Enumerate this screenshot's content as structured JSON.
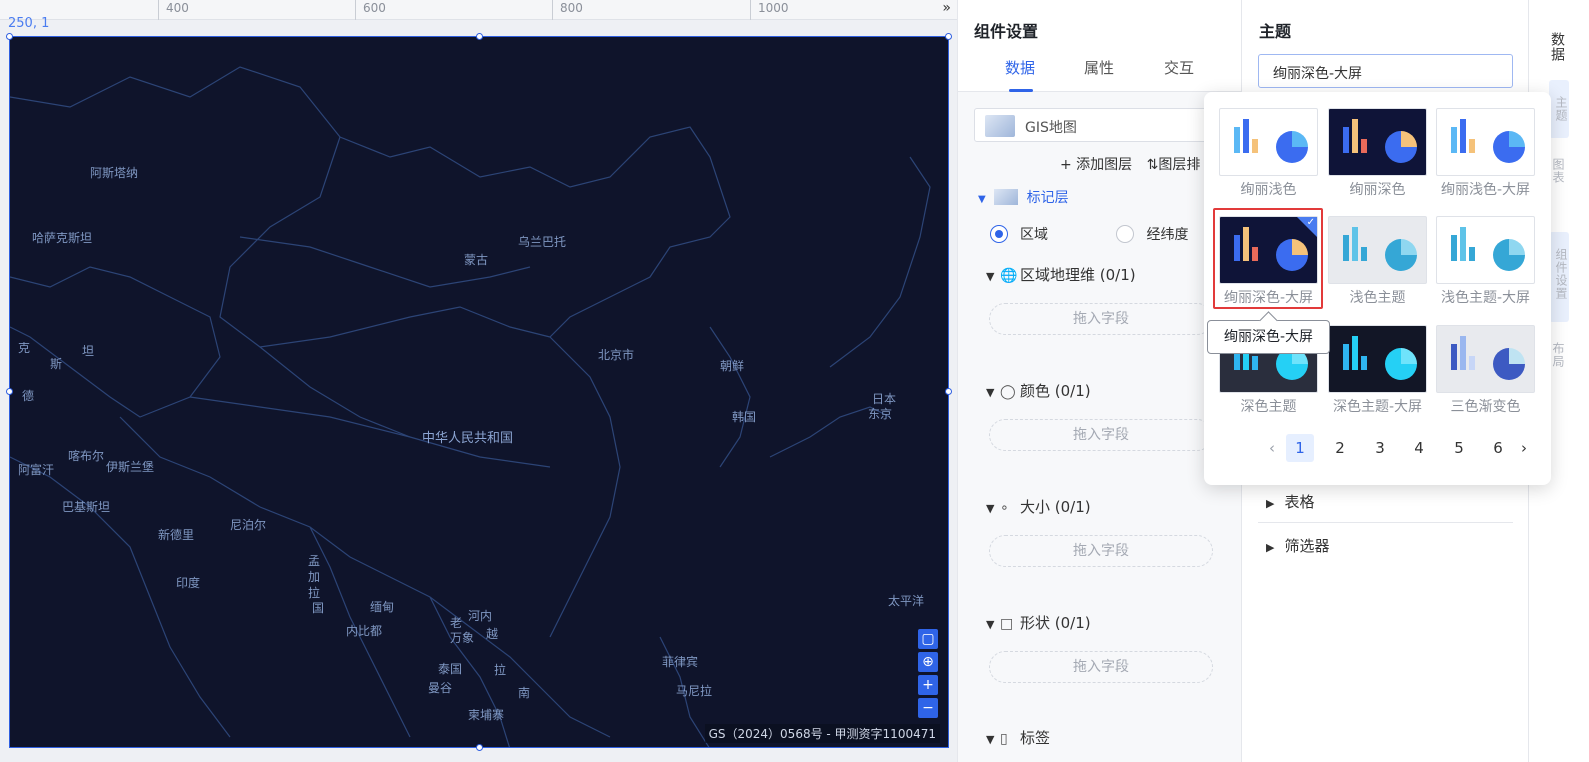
{
  "ruler": {
    "ticks": [
      "400",
      "600",
      "800",
      "1000"
    ],
    "expand_icon": "double-chevron-right-icon"
  },
  "canvas": {
    "coordinate_readout": "250, 1",
    "map": {
      "places": {
        "astana": "阿斯塔纳",
        "kazakhstan": "哈萨克斯坦",
        "mongolia": "蒙古",
        "ulaanbaatar": "乌兰巴托",
        "beijing": "北京市",
        "north_korea": "朝鲜",
        "south_korea": "韩国",
        "japan": "日本",
        "tokyo": "东京",
        "prc": "中华人民共和国",
        "ke": "克",
        "si": "斯",
        "tan": "坦",
        "de": "德",
        "kabul": "喀布尔",
        "islamabad": "伊斯兰堡",
        "afghanistan": "阿富汗",
        "pakistan": "巴基斯坦",
        "nepal": "尼泊尔",
        "new_delhi": "新德里",
        "india": "印度",
        "bangladesh_1": "孟",
        "bangladesh_2": "加",
        "bangladesh_3": "拉",
        "bangladesh_4": "国",
        "myanmar": "缅甸",
        "naypyidaw": "内比都",
        "hanoi": "河内",
        "laos_1": "老",
        "laos_2": "万象",
        "vietnam": "越",
        "thailand": "泰国",
        "bangkok": "曼谷",
        "cambodia_1": "拉",
        "cambodia_2": "南",
        "cambodia": "柬埔寨",
        "philippines": "菲律宾",
        "manila": "马尼拉",
        "pacific": "太平洋"
      },
      "copyright": "GS（2024）0568号 - 甲测资字1100471",
      "controls": [
        "frame-icon",
        "locate-icon",
        "zoom-in-icon",
        "zoom-out-icon"
      ],
      "control_glyphs": [
        "▢",
        "⊕",
        "+",
        "−"
      ],
      "colors": {
        "background": "#0f142b",
        "border": "#2f5fe0",
        "lines": "#2c4476"
      }
    }
  },
  "settings": {
    "title": "组件设置",
    "tabs": [
      "数据",
      "属性",
      "交互"
    ],
    "active_tab": "数据",
    "chart_type": "GIS地图",
    "add_layer": "+ 添加图层",
    "layer_manage": "⇅图层排",
    "layer_name": "标记层",
    "geo_modes": [
      "区域",
      "经纬度"
    ],
    "selected_geo_mode": "区域",
    "sections": [
      {
        "label": "区域地理维 (0/1)",
        "icon": "globe-icon",
        "dropzone": "拖入字段"
      },
      {
        "label": "颜色 (0/1)",
        "icon": "droplet-icon",
        "dropzone": "拖入字段"
      },
      {
        "label": "大小 (0/1)",
        "icon": "size-circles-icon",
        "dropzone": "拖入字段"
      },
      {
        "label": "形状 (0/1)",
        "icon": "shape-icon",
        "dropzone": "拖入字段"
      },
      {
        "label": "标签",
        "icon": "tag-icon"
      }
    ]
  },
  "theme": {
    "title": "主题",
    "current": "绚丽深色-大屏",
    "list_items": [
      "表格",
      "筛选器"
    ],
    "options": [
      {
        "name": "绚丽浅色",
        "bg": "#ffffff",
        "bars": [
          "#5bb8f5",
          "#3b6cf0",
          "#f5c27a"
        ],
        "pie": "#3b6cf0",
        "pie2": "#5bb8f5"
      },
      {
        "name": "绚丽深色",
        "bg": "#0f1438",
        "bars": [
          "#3b6cf0",
          "#f5c27a",
          "#e86a5a"
        ],
        "pie": "#3b6cf0",
        "pie2": "#f5c27a"
      },
      {
        "name": "绚丽浅色-大屏",
        "bg": "#ffffff",
        "bars": [
          "#5bb8f5",
          "#3b6cf0",
          "#f5c27a"
        ],
        "pie": "#3b6cf0",
        "pie2": "#5bb8f5"
      },
      {
        "name": "绚丽深色-大屏",
        "bg": "#0f1438",
        "bars": [
          "#3b6cf0",
          "#f5c27a",
          "#e86a5a"
        ],
        "pie": "#3b6cf0",
        "pie2": "#f5c27a"
      },
      {
        "name": "浅色主题",
        "bg": "#e8eaee",
        "bars": [
          "#35a7d6",
          "#5ec3e8",
          "#35a7d6"
        ],
        "pie": "#35a7d6",
        "pie2": "#8fd7f0"
      },
      {
        "name": "浅色主题-大屏",
        "bg": "#ffffff",
        "bars": [
          "#35a7d6",
          "#5ec3e8",
          "#35a7d6"
        ],
        "pie": "#35a7d6",
        "pie2": "#8fd7f0"
      },
      {
        "name": "深色主题",
        "bg": "#2a2e3d",
        "bars": [
          "#2fb5f0",
          "#25d0f5",
          "#2fb5f0"
        ],
        "pie": "#25d0f5",
        "pie2": "#6fe3fb"
      },
      {
        "name": "深色主题-大屏",
        "bg": "#121626",
        "bars": [
          "#2fb5f0",
          "#25d0f5",
          "#2fb5f0"
        ],
        "pie": "#25d0f5",
        "pie2": "#6fe3fb"
      },
      {
        "name": "三色渐变色",
        "bg": "#e8eaee",
        "bars": [
          "#3d5ac2",
          "#9ab7ef",
          "#c7d6f7"
        ],
        "pie": "#3d5ac2",
        "pie2": "#bfe3f2"
      }
    ],
    "selected": "绚丽深色-大屏",
    "tooltip": "绚丽深色-大屏",
    "pagination": {
      "pages": [
        "1",
        "2",
        "3",
        "4",
        "5",
        "6"
      ],
      "current": "1",
      "prev_icon": "chevron-left-icon",
      "next_icon": "chevron-right-icon"
    }
  },
  "rail": {
    "items": [
      {
        "label": "数据",
        "faded": false
      },
      {
        "label": "主题",
        "faded": true
      },
      {
        "label": "图表",
        "faded": true
      },
      {
        "label": "组件设置",
        "faded": true
      },
      {
        "label": "布局",
        "faded": true
      }
    ]
  }
}
